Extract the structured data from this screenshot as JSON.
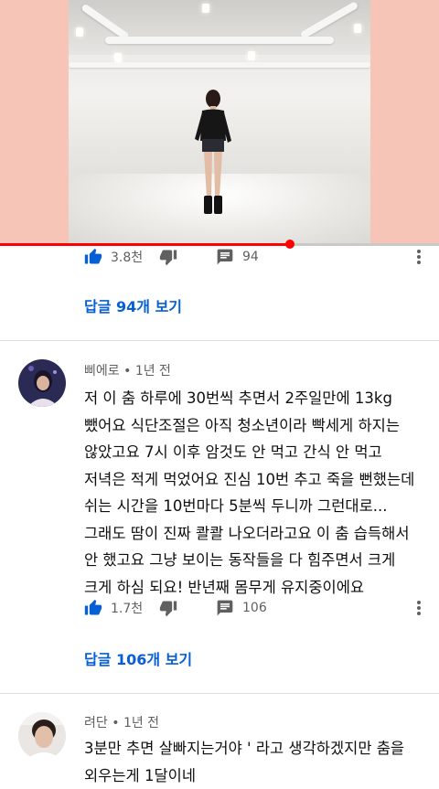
{
  "video": {
    "progress_fraction": 0.66
  },
  "top_comment_actions": {
    "like_count": "3.8천",
    "reply_count": "94",
    "view_replies_label": "답글 94개 보기"
  },
  "comments": [
    {
      "author": "삐에로",
      "time": "1년 전",
      "text": "저 이 춤 하루에 30번씩 추면서 2주일만에 13kg 뺐어요 식단조절은 아직 청소년이라 빡세게 하지는 않았고요 7시 이후 암것도 안 먹고 간식 안 먹고 저녁은 적게 먹었어요 진심 10번 추고 죽을 뻔했는데 쉬는 시간을 10번마다 5분씩 두니까 그런대로... 그래도 땀이 진짜 콸콸 나오더라고요 이 춤 습득해서 안 했고요 그냥 보이는 동작들을 다 힘주면서 크게 크게 하심 되요! 반년째 몸무게 유지중이에요",
      "like_count": "1.7천",
      "reply_count": "106",
      "view_replies_label": "답글 106개 보기"
    },
    {
      "author": "려단",
      "time": "1년 전",
      "text": "3분만 추면 살빠지는거야 ' 라고 생각하겠지만 춤을 외우는게 1달이네"
    }
  ],
  "separator": "•",
  "colors": {
    "accent_blue": "#065fd4",
    "progress_red": "#ff0000",
    "player_bg": "#f7c5b8"
  }
}
